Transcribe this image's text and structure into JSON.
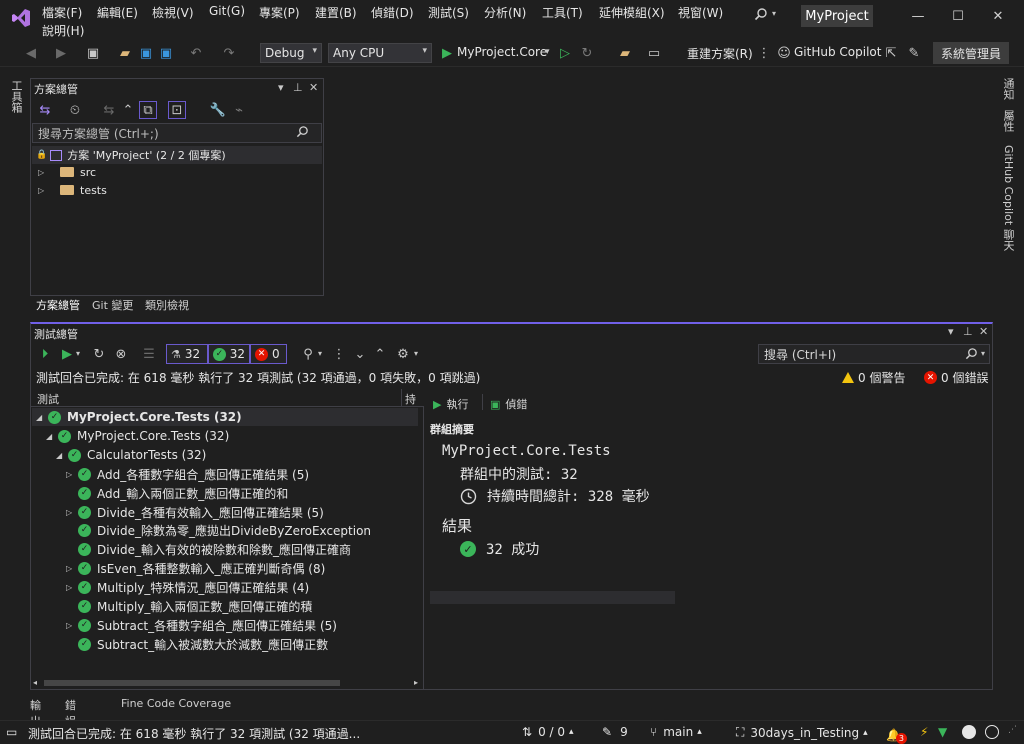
{
  "menu": {
    "items": [
      "檔案(F)",
      "編輯(E)",
      "檢視(V)",
      "Git(G)",
      "專案(P)",
      "建置(B)",
      "偵錯(D)",
      "測試(S)",
      "分析(N)",
      "工具(T)",
      "延伸模組(X)",
      "視窗(W)"
    ],
    "help": "說明(H)",
    "project_name": "MyProject"
  },
  "toolbar": {
    "config": "Debug",
    "platform": "Any CPU",
    "start_target": "MyProject.Core",
    "rebuild_label": "重建方案(R)",
    "copilot_label": "GitHub Copilot",
    "admin_label": "系統管理員"
  },
  "left_strip": {
    "toolbox": "工具箱"
  },
  "right_strip": {
    "notifications": "通知",
    "properties": "屬性",
    "copilot_chat": "GitHub Copilot 聊天"
  },
  "solution_explorer": {
    "title": "方案總管",
    "search_placeholder": "搜尋方案總管 (Ctrl+;)",
    "root": "方案 'MyProject' (2 / 2 個專案)",
    "folders": [
      "src",
      "tests"
    ],
    "tabs": [
      "方案總管",
      "Git 變更",
      "類別檢視"
    ]
  },
  "test_explorer": {
    "title": "測試總管",
    "counts": {
      "total": "32",
      "passed": "32",
      "failed": "0"
    },
    "search_placeholder": "搜尋 (Ctrl+I)",
    "status": "測試回合已完成: 在 618 毫秒 執行了 32 項測試 (32 項通過，0 項失敗，0 項跳過)",
    "warnings": "0 個警告",
    "errors": "0 個錯誤",
    "col_test": "測試",
    "col_duration": "持續",
    "tree": [
      {
        "label": "MyProject.Core.Tests (32)",
        "level": 0,
        "expandable": true,
        "expanded": true
      },
      {
        "label": "MyProject.Core.Tests (32)",
        "level": 1,
        "expandable": true,
        "expanded": true
      },
      {
        "label": "CalculatorTests (32)",
        "level": 2,
        "expandable": true,
        "expanded": true
      },
      {
        "label": "Add_各種數字組合_應回傳正確結果 (5)",
        "level": 3,
        "expandable": true,
        "expanded": false
      },
      {
        "label": "Add_輸入兩個正數_應回傳正確的和",
        "level": 3,
        "expandable": false
      },
      {
        "label": "Divide_各種有效輸入_應回傳正確結果 (5)",
        "level": 3,
        "expandable": true,
        "expanded": false
      },
      {
        "label": "Divide_除數為零_應拋出DivideByZeroException",
        "level": 3,
        "expandable": false
      },
      {
        "label": "Divide_輸入有效的被除數和除數_應回傳正確商",
        "level": 3,
        "expandable": false
      },
      {
        "label": "IsEven_各種整數輸入_應正確判斷奇偶 (8)",
        "level": 3,
        "expandable": true,
        "expanded": false
      },
      {
        "label": "Multiply_特殊情況_應回傳正確結果 (4)",
        "level": 3,
        "expandable": true,
        "expanded": false
      },
      {
        "label": "Multiply_輸入兩個正數_應回傳正確的積",
        "level": 3,
        "expandable": false
      },
      {
        "label": "Subtract_各種數字組合_應回傳正確結果 (5)",
        "level": 3,
        "expandable": true,
        "expanded": false
      },
      {
        "label": "Subtract_輸入被減數大於減數_應回傳正數",
        "level": 3,
        "expandable": false
      }
    ],
    "detail": {
      "run_label": "執行",
      "debug_label": "偵錯",
      "section": "群組摘要",
      "group_name": "MyProject.Core.Tests",
      "tests_in_group": "群組中的測試: 32",
      "total_duration": "持續時間總計: 328 毫秒",
      "results_heading": "結果",
      "passed": "32 成功"
    }
  },
  "bottom_tabs": [
    "輸出",
    "錯誤清單",
    "Fine Code Coverage"
  ],
  "statusbar": {
    "message": "測試回合已完成: 在 618 毫秒 執行了 32 項測試 (32 項通過...",
    "sync": "0 / 0",
    "pencil_count": "9",
    "branch": "main",
    "repo": "30days_in_Testing",
    "notif_count": "3"
  }
}
